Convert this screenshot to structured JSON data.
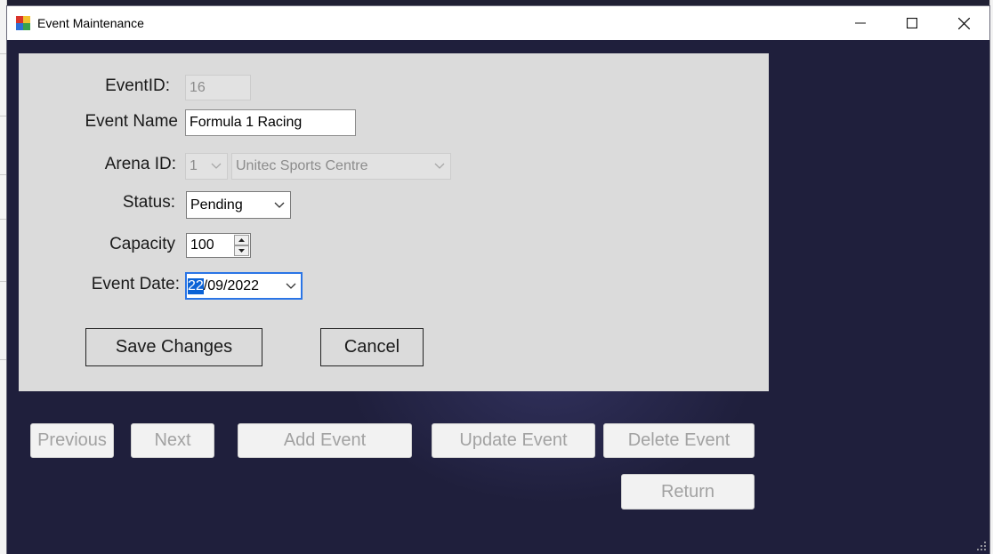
{
  "window": {
    "title": "Event Maintenance"
  },
  "form": {
    "event_id": {
      "label": "EventID:",
      "value": "16"
    },
    "event_name": {
      "label": "Event Name",
      "value": "Formula 1 Racing"
    },
    "arena": {
      "label": "Arena ID:",
      "id_value": "1",
      "name_value": "Unitec Sports Centre"
    },
    "status": {
      "label": "Status:",
      "value": "Pending"
    },
    "capacity": {
      "label": "Capacity",
      "value": "100"
    },
    "event_date": {
      "label": "Event Date:",
      "day": "22",
      "rest": "/09/2022"
    },
    "save_label": "Save Changes",
    "cancel_label": "Cancel"
  },
  "nav": {
    "previous": "Previous",
    "next": "Next",
    "add": "Add Event",
    "update": "Update Event",
    "delete": "Delete Event",
    "return": "Return"
  },
  "colors": {
    "window_bg": "#1f1f3c",
    "panel_bg": "#dbdbdb",
    "selection": "#0a62d6",
    "disabled_text": "#a2a2a2"
  },
  "icons": {
    "app": "app-icon",
    "minimize": "minimize-icon",
    "maximize": "maximize-icon",
    "close": "close-icon"
  }
}
